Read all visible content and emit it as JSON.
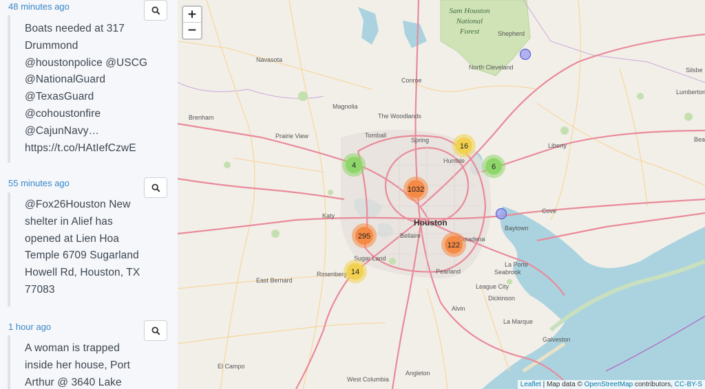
{
  "feed": {
    "entries": [
      {
        "time": "48 minutes ago",
        "lines": [
          "Boats needed at 317",
          "Drummond",
          "@houstonpolice @USCG",
          "@NationalGuard",
          "@TexasGuard",
          "@cohoustonfire",
          "@CajunNavy…",
          "https://t.co/HAtIefCzwE"
        ]
      },
      {
        "time": "55 minutes ago",
        "lines": [
          "@Fox26Houston New",
          "shelter in Alief has",
          "opened at Lien Hoa",
          "Temple 6709 Sugarland",
          "Howell Rd, Houston, TX",
          "77083"
        ]
      },
      {
        "time": "1 hour ago",
        "lines": [
          "A woman is trapped",
          "inside her house, Port",
          "Arthur @ 3640 Lake"
        ]
      }
    ]
  },
  "map": {
    "zoom_in": "+",
    "zoom_out": "−",
    "colors": {
      "small": "#8fd66a",
      "medium": "#f2d14e",
      "large": "#f58a45",
      "point": "#9a9ff0"
    },
    "clusters": [
      {
        "count": "16",
        "size": "medium"
      },
      {
        "count": "4",
        "size": "small"
      },
      {
        "count": "6",
        "size": "small"
      },
      {
        "count": "1032",
        "size": "large"
      },
      {
        "count": "295",
        "size": "large"
      },
      {
        "count": "122",
        "size": "large"
      },
      {
        "count": "14",
        "size": "medium"
      }
    ],
    "places": {
      "sam_houston_1": "Sam Houston",
      "sam_houston_2": "National",
      "sam_houston_3": "Forest",
      "shepherd": "Shepherd",
      "navasota": "Navasota",
      "north_cleveland": "North Cleveland",
      "conroe": "Conroe",
      "magnolia": "Magnolia",
      "the_woodlands": "The Woodlands",
      "brenham": "Brenham",
      "prairie_view": "Prairie View",
      "tomball": "Tomball",
      "spring": "Spring",
      "humble": "Humble",
      "liberty": "Liberty",
      "katy": "Katy",
      "houston": "Houston",
      "bellaire": "Bellaire",
      "pasadena": "Pasadena",
      "baytown": "Baytown",
      "cove": "Cove",
      "la_porte": "La Porte",
      "sugar_land": "Sugar Land",
      "rosenberg": "Rosenberg",
      "east_bernard": "East Bernard",
      "pearland": "Pearland",
      "seabrook": "Seabrook",
      "league_city": "League City",
      "dickinson": "Dickinson",
      "alvin": "Alvin",
      "la_marque": "La Marque",
      "galveston": "Galveston",
      "el_campo": "El Campo",
      "west_columbia": "West Columbia",
      "angleton": "Angleton",
      "lumberton": "Lumberton",
      "silsbee": "Silsbe",
      "beaumont": "Bea"
    },
    "attribution": {
      "leaflet": "Leaflet",
      "sep1": " | Map data © ",
      "osm": "OpenStreetMap",
      "contrib": " contributors, ",
      "license": "CC-BY-S"
    }
  }
}
